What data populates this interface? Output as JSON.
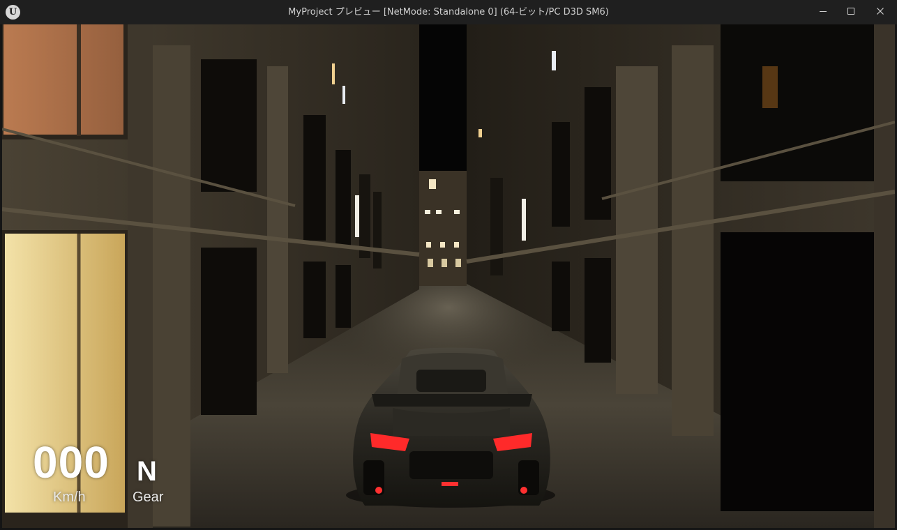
{
  "window": {
    "title": "MyProject プレビュー [NetMode: Standalone 0]  (64-ビット/PC D3D SM6)",
    "logo_icon": "unreal-engine-logo-icon",
    "controls": {
      "minimize_icon": "minimize-icon",
      "maximize_icon": "maximize-icon",
      "close_icon": "close-icon"
    }
  },
  "hud": {
    "speed": {
      "value": "000",
      "unit": "Km/h"
    },
    "gear": {
      "value": "N",
      "label": "Gear"
    }
  },
  "colors": {
    "titlebar": "#1f1f1f",
    "hud_text": "#ffffff",
    "taillight": "#ff2a2a"
  }
}
